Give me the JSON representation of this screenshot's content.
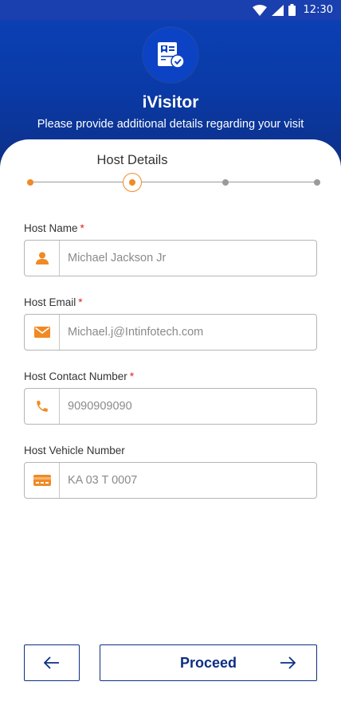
{
  "status_bar": {
    "time": "12:30",
    "icons": [
      "wifi-icon",
      "signal-icon",
      "battery-icon"
    ]
  },
  "header": {
    "logo_icon": "visitor-badge-icon",
    "title": "iVisitor",
    "subtitle": "Please provide additional details regarding your visit"
  },
  "stepper": {
    "current_title": "Host Details",
    "total_steps": 4,
    "current_step": 2
  },
  "form": {
    "fields": [
      {
        "label": "Host Name",
        "required": "*",
        "placeholder": "Michael Jackson Jr",
        "icon": "person-icon"
      },
      {
        "label": "Host Email",
        "required": "*",
        "placeholder": "Michael.j@Intinfotech.com",
        "icon": "mail-icon"
      },
      {
        "label": "Host Contact Number",
        "required": "*",
        "placeholder": "9090909090",
        "icon": "phone-icon"
      },
      {
        "label": "Host Vehicle Number",
        "required": "",
        "placeholder": "KA 03 T 0007",
        "icon": "card-icon"
      }
    ]
  },
  "actions": {
    "back_icon": "arrow-left-icon",
    "proceed_label": "Proceed",
    "proceed_icon": "arrow-right-icon"
  },
  "colors": {
    "brand_blue": "#0a3aa6",
    "dark_blue": "#0d2e83",
    "accent_orange": "#f08a24",
    "required_red": "#e0201c"
  }
}
